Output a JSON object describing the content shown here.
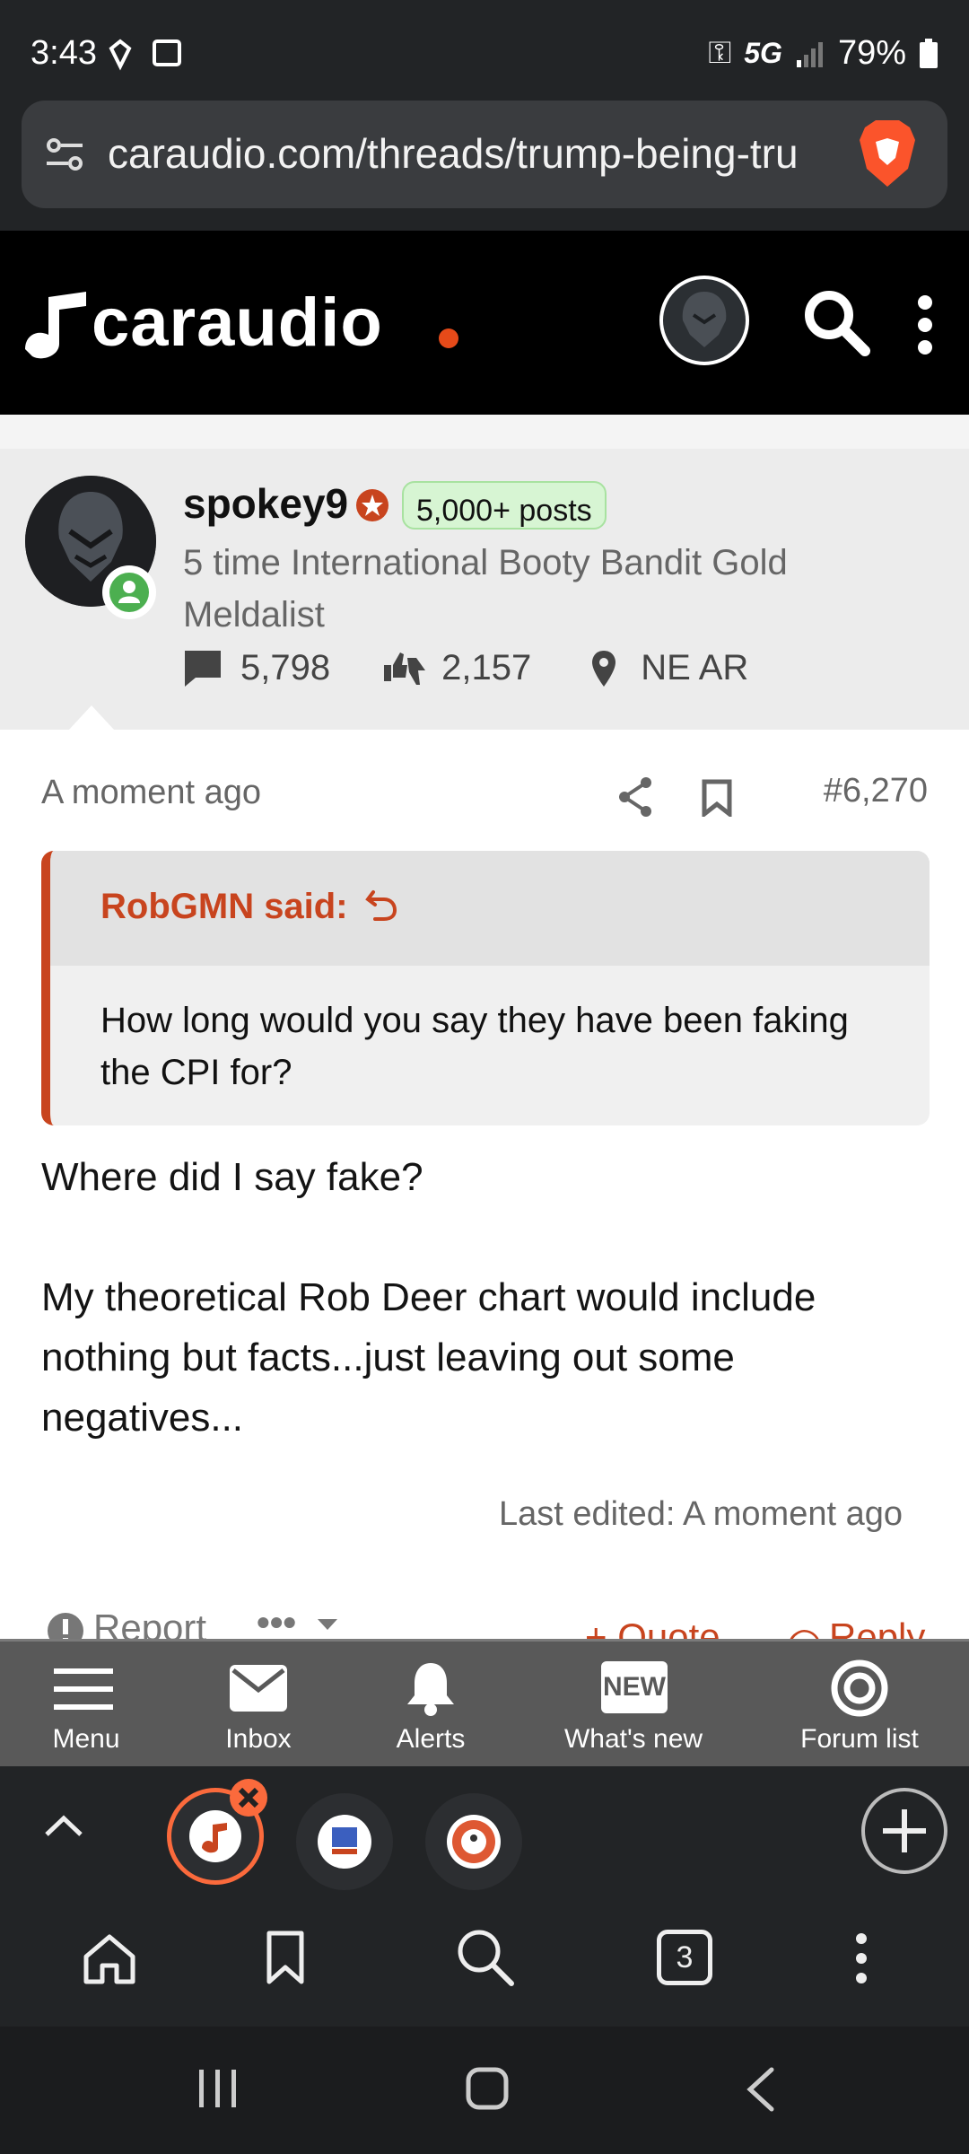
{
  "status_bar": {
    "time": "3:43",
    "network": "5G",
    "battery": "79%"
  },
  "browser": {
    "url": "caraudio.com/threads/trump-being-tru",
    "tab_count": "3"
  },
  "site": {
    "logo_text": "caraudio",
    "accent": "#e64a19"
  },
  "profile": {
    "username": "spokey9",
    "badge": "5,000+ posts",
    "title": "5 time International Booty Bandit Gold Meldalist",
    "messages": "5,798",
    "reactions": "2,157",
    "location": "NE AR"
  },
  "post": {
    "time": "A moment ago",
    "number": "#6,270",
    "quote_author": "RobGMN said:",
    "quote_text": "How long would you say they have been faking the CPI for?",
    "body_line1": "Where did I say fake?",
    "body_line2": "My theoretical Rob Deer chart would include nothing but facts...just leaving out some negatives...",
    "last_edited": "Last edited: A moment ago",
    "actions": {
      "report": "Report",
      "more": "•••",
      "quote": "+ Quote",
      "reply": "Reply"
    }
  },
  "forum_nav": [
    {
      "label": "Menu",
      "icon": "menu-icon"
    },
    {
      "label": "Inbox",
      "icon": "inbox-icon"
    },
    {
      "label": "Alerts",
      "icon": "bell-icon"
    },
    {
      "label": "What's new",
      "icon": "new-icon"
    },
    {
      "label": "Forum list",
      "icon": "forum-list-icon"
    }
  ],
  "new_badge_text": "NEW"
}
